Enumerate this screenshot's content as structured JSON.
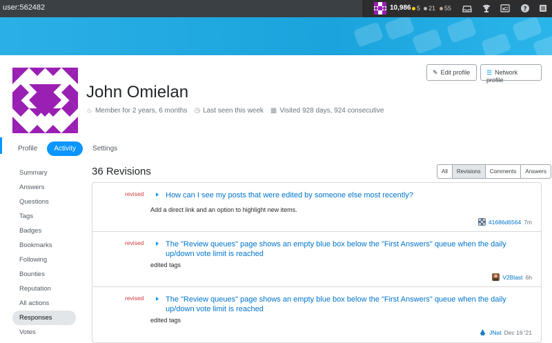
{
  "topbar": {
    "user_label": "user:562482",
    "reputation": "10,986",
    "badges": {
      "gold": "5",
      "silver": "21",
      "bronze": "55"
    },
    "colors": {
      "gold": "#ffcc01",
      "silver": "#b4b8bc",
      "bronze": "#d1a684"
    },
    "icons": [
      "inbox-icon",
      "trophy-icon",
      "review-icon",
      "help-icon",
      "menu-icon"
    ]
  },
  "profile": {
    "name": "John Omielan",
    "member_for": "Member for 2 years, 6 months",
    "last_seen": "Last seen this week",
    "visited": "Visited 928 days, 924 consecutive",
    "edit_label": "Edit profile",
    "network_label": "Network profile",
    "avatar_color": "#9a1fb3"
  },
  "tabs": [
    {
      "label": "Profile"
    },
    {
      "label": "Activity",
      "active": true
    },
    {
      "label": "Settings"
    }
  ],
  "sidenav": [
    {
      "label": "Summary"
    },
    {
      "label": "Answers"
    },
    {
      "label": "Questions"
    },
    {
      "label": "Tags"
    },
    {
      "label": "Badges"
    },
    {
      "label": "Bookmarks"
    },
    {
      "label": "Following"
    },
    {
      "label": "Bounties"
    },
    {
      "label": "Reputation"
    },
    {
      "label": "All actions"
    },
    {
      "label": "Responses",
      "active": true
    },
    {
      "label": "Votes"
    }
  ],
  "main": {
    "heading": "36 Revisions",
    "filters": [
      "All",
      "Revisions",
      "Comments",
      "Answers"
    ],
    "active_filter": "Revisions",
    "revisions": [
      {
        "type": "revised",
        "title": "How can I see my posts that were edited by someone else most recently?",
        "comment": "Add a direct link and an option to highlight new items.",
        "user": "41686d6564",
        "time": "7m"
      },
      {
        "type": "revised",
        "title": "The \"Review queues\" page shows an empty blue box below the \"First Answers\" queue when the daily up/down vote limit is reached",
        "comment": "edited tags",
        "user": "V2Blast",
        "time": "6h"
      },
      {
        "type": "revised",
        "title": "The \"Review queues\" page shows an empty blue box below the \"First Answers\" queue when the daily up/down vote limit is reached",
        "comment": "edited tags",
        "user": "JNat",
        "time": "Dec 16 '21"
      }
    ]
  }
}
